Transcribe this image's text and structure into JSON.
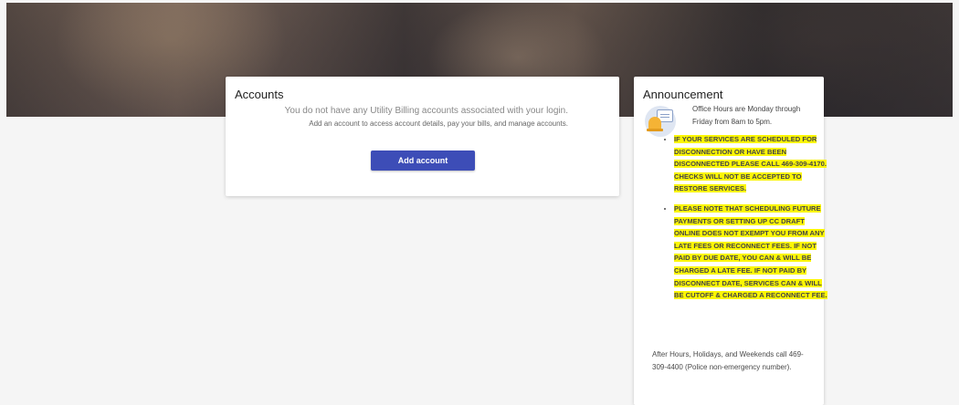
{
  "accounts": {
    "title": "Accounts",
    "empty_message": "You do not have any Utility Billing accounts associated with your login.",
    "help_text": "Add an account to access account details, pay your bills, and manage accounts.",
    "add_button_label": "Add account"
  },
  "announcement": {
    "title": "Announcement",
    "icon": "announcement-bell-icon",
    "office_hours": "Office Hours are Monday through Friday from 8am to 5pm.",
    "notices": [
      "IF YOUR SERVICES ARE SCHEDULED FOR DISCONNECTION OR HAVE BEEN DISCONNECTED PLEASE CALL 469-309-4170. CHECKS WILL NOT BE ACCEPTED TO RESTORE SERVICES.",
      "PLEASE NOTE THAT SCHEDULING FUTURE PAYMENTS OR SETTING UP CC DRAFT ONLINE DOES NOT EXEMPT YOU FROM ANY LATE FEES OR RECONNECT FEES. IF NOT PAID BY DUE DATE, YOU CAN & WILL BE CHARGED A LATE FEE. IF NOT PAID BY DISCONNECT DATE, SERVICES CAN & WILL BE CUTOFF & CHARGED A RECONNECT FEE."
    ],
    "after_hours": "After Hours, Holidays, and Weekends call 469-309-4400 (Police non-emergency number)."
  },
  "colors": {
    "primary_button": "#3d4db7",
    "highlight": "#fcf604",
    "page_background": "#f5f5f5"
  }
}
